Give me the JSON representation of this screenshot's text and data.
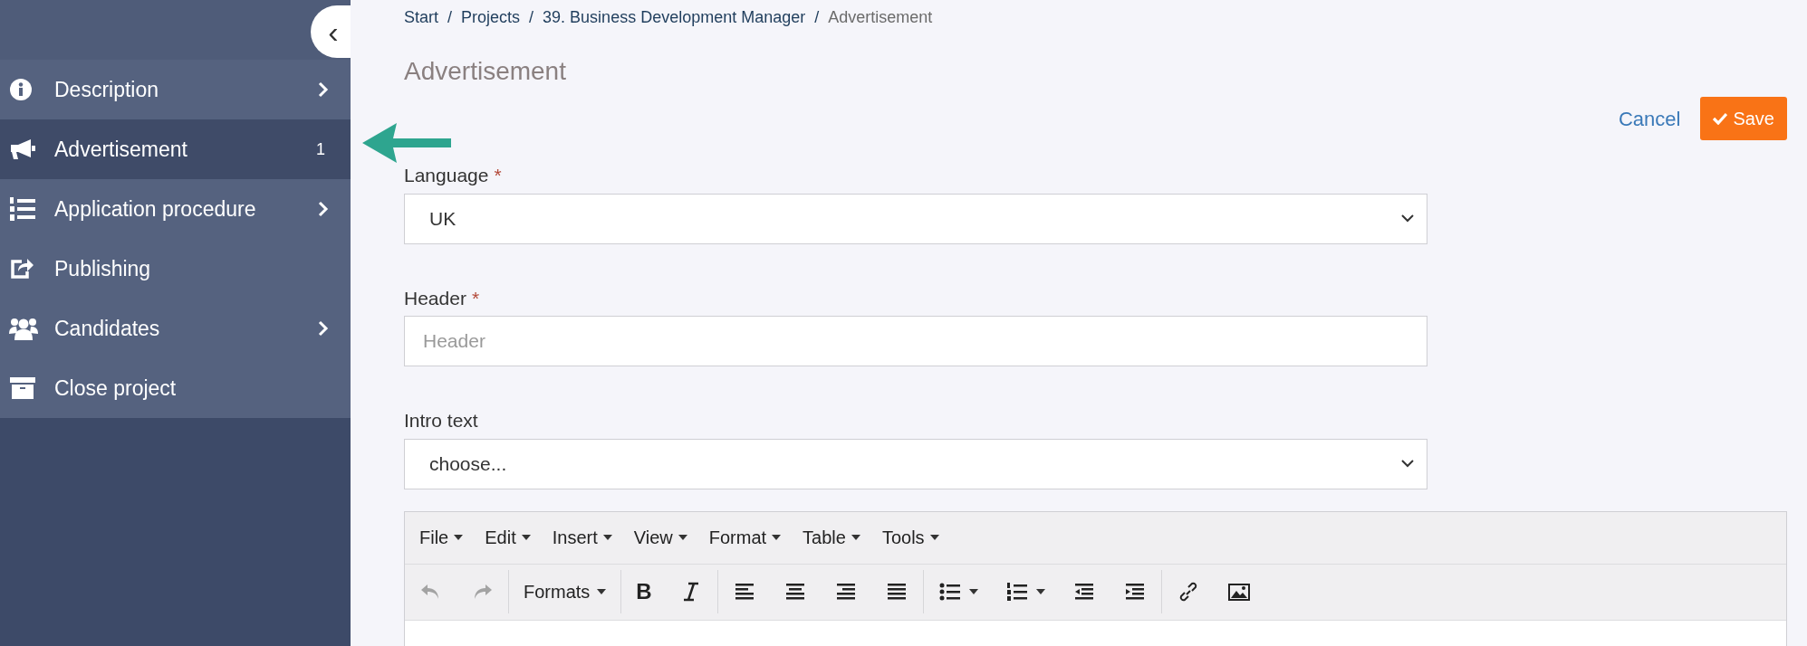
{
  "sidebar": {
    "collapse_icon": "‹",
    "items": [
      {
        "kind": "info",
        "label": "Description",
        "has_submenu": true,
        "selected": false
      },
      {
        "kind": "megaphone",
        "label": "Advertisement",
        "badge": "1",
        "has_submenu": false,
        "selected": true
      },
      {
        "kind": "numbered-list",
        "label": "Application procedure",
        "has_submenu": true,
        "selected": false
      },
      {
        "kind": "share",
        "label": "Publishing",
        "has_submenu": false,
        "selected": false
      },
      {
        "kind": "users",
        "label": "Candidates",
        "has_submenu": true,
        "selected": false
      },
      {
        "kind": "archive",
        "label": "Close project",
        "has_submenu": false,
        "selected": false
      }
    ]
  },
  "breadcrumb": [
    {
      "label": "Start",
      "current": false
    },
    {
      "separator": "/",
      "label": "Projects",
      "current": false
    },
    {
      "separator": "/",
      "label": "39. Business Development Manager",
      "current": false
    },
    {
      "separator": "/",
      "label": "Advertisement",
      "current": true
    }
  ],
  "page_title": "Advertisement",
  "actions": {
    "cancel": "Cancel",
    "save": "Save"
  },
  "form": {
    "fields": [
      {
        "kind": "select",
        "label": "Language",
        "required_mark": "*",
        "value": "UK"
      },
      {
        "kind": "text",
        "label": "Header",
        "required_mark": "*",
        "placeholder": "Header"
      },
      {
        "kind": "select",
        "label": "Intro text",
        "value": "choose..."
      }
    ]
  },
  "editor": {
    "menus": [
      "File",
      "Edit",
      "Insert",
      "View",
      "Format",
      "Table",
      "Tools"
    ],
    "toolbar": [
      {
        "buttons": [
          {
            "kind": "undo",
            "disabled": true
          },
          {
            "kind": "redo",
            "disabled": true
          }
        ]
      },
      {
        "buttons": [
          {
            "kind": "formats",
            "label": "Formats",
            "disabled": false
          }
        ]
      },
      {
        "buttons": [
          {
            "kind": "bold",
            "label": "B",
            "disabled": false
          },
          {
            "kind": "italic",
            "disabled": false
          }
        ]
      },
      {
        "buttons": [
          {
            "kind": "align-left",
            "disabled": false
          },
          {
            "kind": "align-center",
            "disabled": false
          },
          {
            "kind": "align-right",
            "disabled": false
          },
          {
            "kind": "justify",
            "disabled": false
          }
        ]
      },
      {
        "buttons": [
          {
            "kind": "bullet-list",
            "disabled": false
          },
          {
            "kind": "numbered-list",
            "disabled": false
          },
          {
            "kind": "outdent",
            "disabled": false
          },
          {
            "kind": "indent",
            "disabled": false
          }
        ]
      },
      {
        "buttons": [
          {
            "kind": "link",
            "disabled": false
          },
          {
            "kind": "image",
            "disabled": false
          }
        ]
      }
    ]
  }
}
